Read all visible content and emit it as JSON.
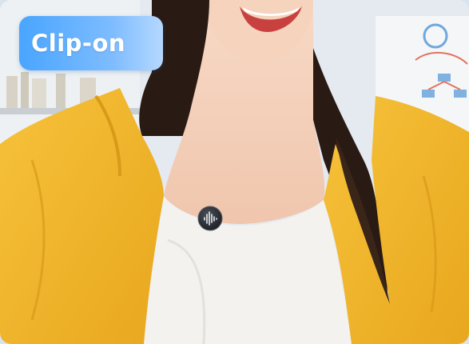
{
  "badge": {
    "label": "Clip-on"
  },
  "colors": {
    "badge_gradient_start": "#49a5ff",
    "badge_gradient_end": "#b5d8ff",
    "jacket": "#f2b62b",
    "shirt": "#f3f1ee",
    "hair": "#2a1a14",
    "microphone": "#2b2f36"
  },
  "icons": {
    "microphone_logo": "waveform-icon"
  }
}
